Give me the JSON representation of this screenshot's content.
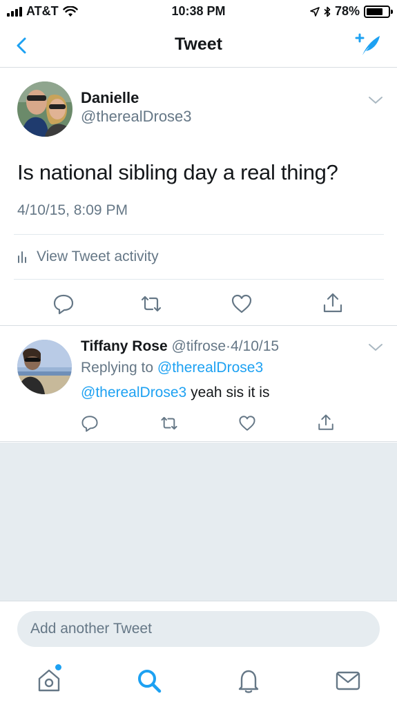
{
  "status_bar": {
    "carrier": "AT&T",
    "time": "10:38 PM",
    "battery": "78%",
    "battery_level": 0.78
  },
  "nav": {
    "title": "Tweet",
    "back_icon": "chevron-left-icon",
    "compose_icon": "compose-tweet-icon"
  },
  "main_tweet": {
    "author_name": "Danielle",
    "author_handle": "@therealDrose3",
    "text": "Is national sibling day a real thing?",
    "timestamp": "4/10/15, 8:09 PM",
    "activity_label": "View Tweet activity"
  },
  "reply": {
    "author_name": "Tiffany Rose",
    "author_handle": "@tifrose",
    "separator": "·",
    "date": "4/10/15",
    "replying_prefix": "Replying to",
    "replying_to": "@therealDrose3",
    "mention": "@therealDrose3",
    "text": " yeah sis it is"
  },
  "composer": {
    "placeholder": "Add another Tweet"
  },
  "tab_bar": {
    "items": [
      "home-icon",
      "search-icon",
      "notifications-icon",
      "messages-icon"
    ]
  },
  "colors": {
    "accent": "#1da1f2",
    "text": "#14171a",
    "secondary": "#657786",
    "background_empty": "#e6ecf0"
  }
}
